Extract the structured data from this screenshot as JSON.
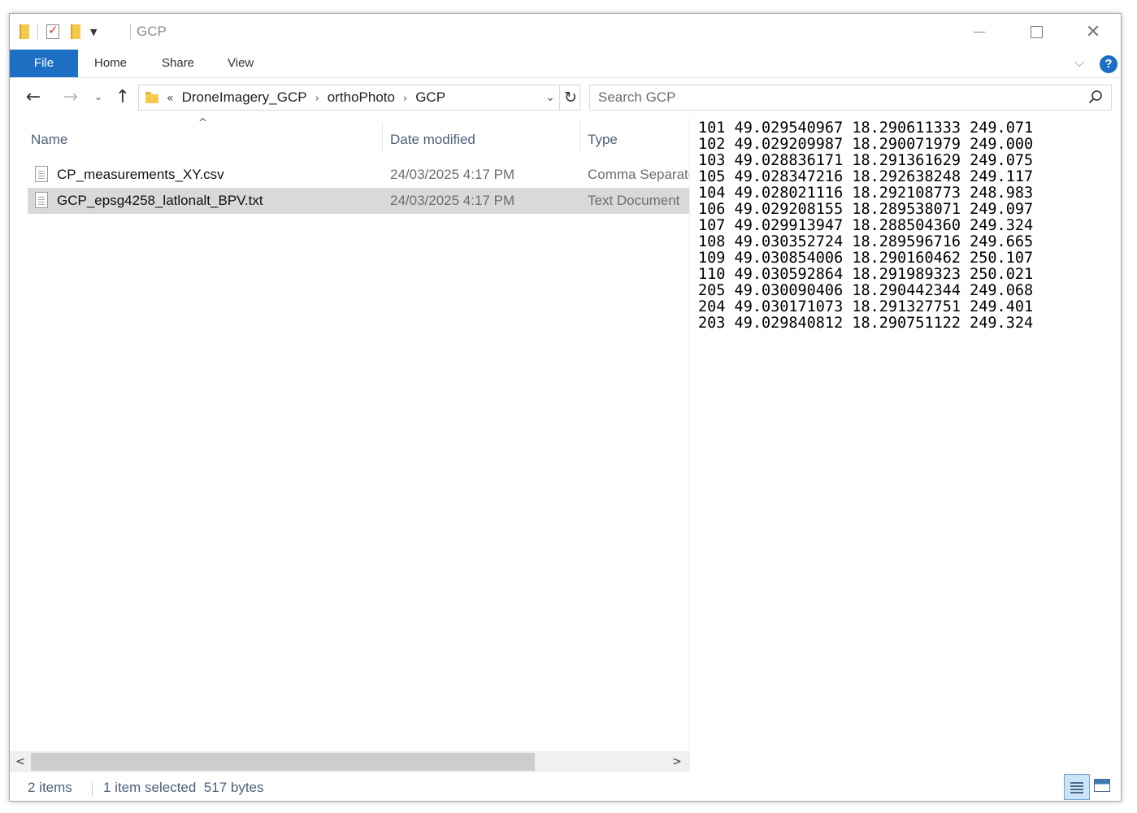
{
  "window": {
    "title": "GCP"
  },
  "ribbon": {
    "tabs": [
      "File",
      "Home",
      "Share",
      "View"
    ]
  },
  "address": {
    "overflow": "«",
    "crumbs": [
      "DroneImagery_GCP",
      "orthoPhoto",
      "GCP"
    ]
  },
  "search": {
    "placeholder": "Search GCP"
  },
  "columns": {
    "name": "Name",
    "date": "Date modified",
    "type": "Type"
  },
  "files": [
    {
      "name": "CP_measurements_XY.csv",
      "date": "24/03/2025 4:17 PM",
      "type": "Comma Separated Values File",
      "selected": false
    },
    {
      "name": "GCP_epsg4258_latlonalt_BPV.txt",
      "date": "24/03/2025 4:17 PM",
      "type": "Text Document",
      "selected": true
    }
  ],
  "preview": {
    "lines": [
      "101 49.029540967 18.290611333 249.071",
      "102 49.029209987 18.290071979 249.000",
      "103 49.028836171 18.291361629 249.075",
      "105 49.028347216 18.292638248 249.117",
      "104 49.028021116 18.292108773 248.983",
      "106 49.029208155 18.289538071 249.097",
      "107 49.029913947 18.288504360 249.324",
      "108 49.030352724 18.289596716 249.665",
      "109 49.030854006 18.290160462 250.107",
      "110 49.030592864 18.291989323 250.021",
      "205 49.030090406 18.290442344 249.068",
      "204 49.030171073 18.291327751 249.401",
      "203 49.029840812 18.290751122 249.324"
    ]
  },
  "status": {
    "items": "2 items",
    "selection": "1 item selected  517 bytes"
  },
  "colors": {
    "accent": "#1d6fc4",
    "selected_row": "#d9d9d9",
    "header_text": "#4c607a"
  }
}
